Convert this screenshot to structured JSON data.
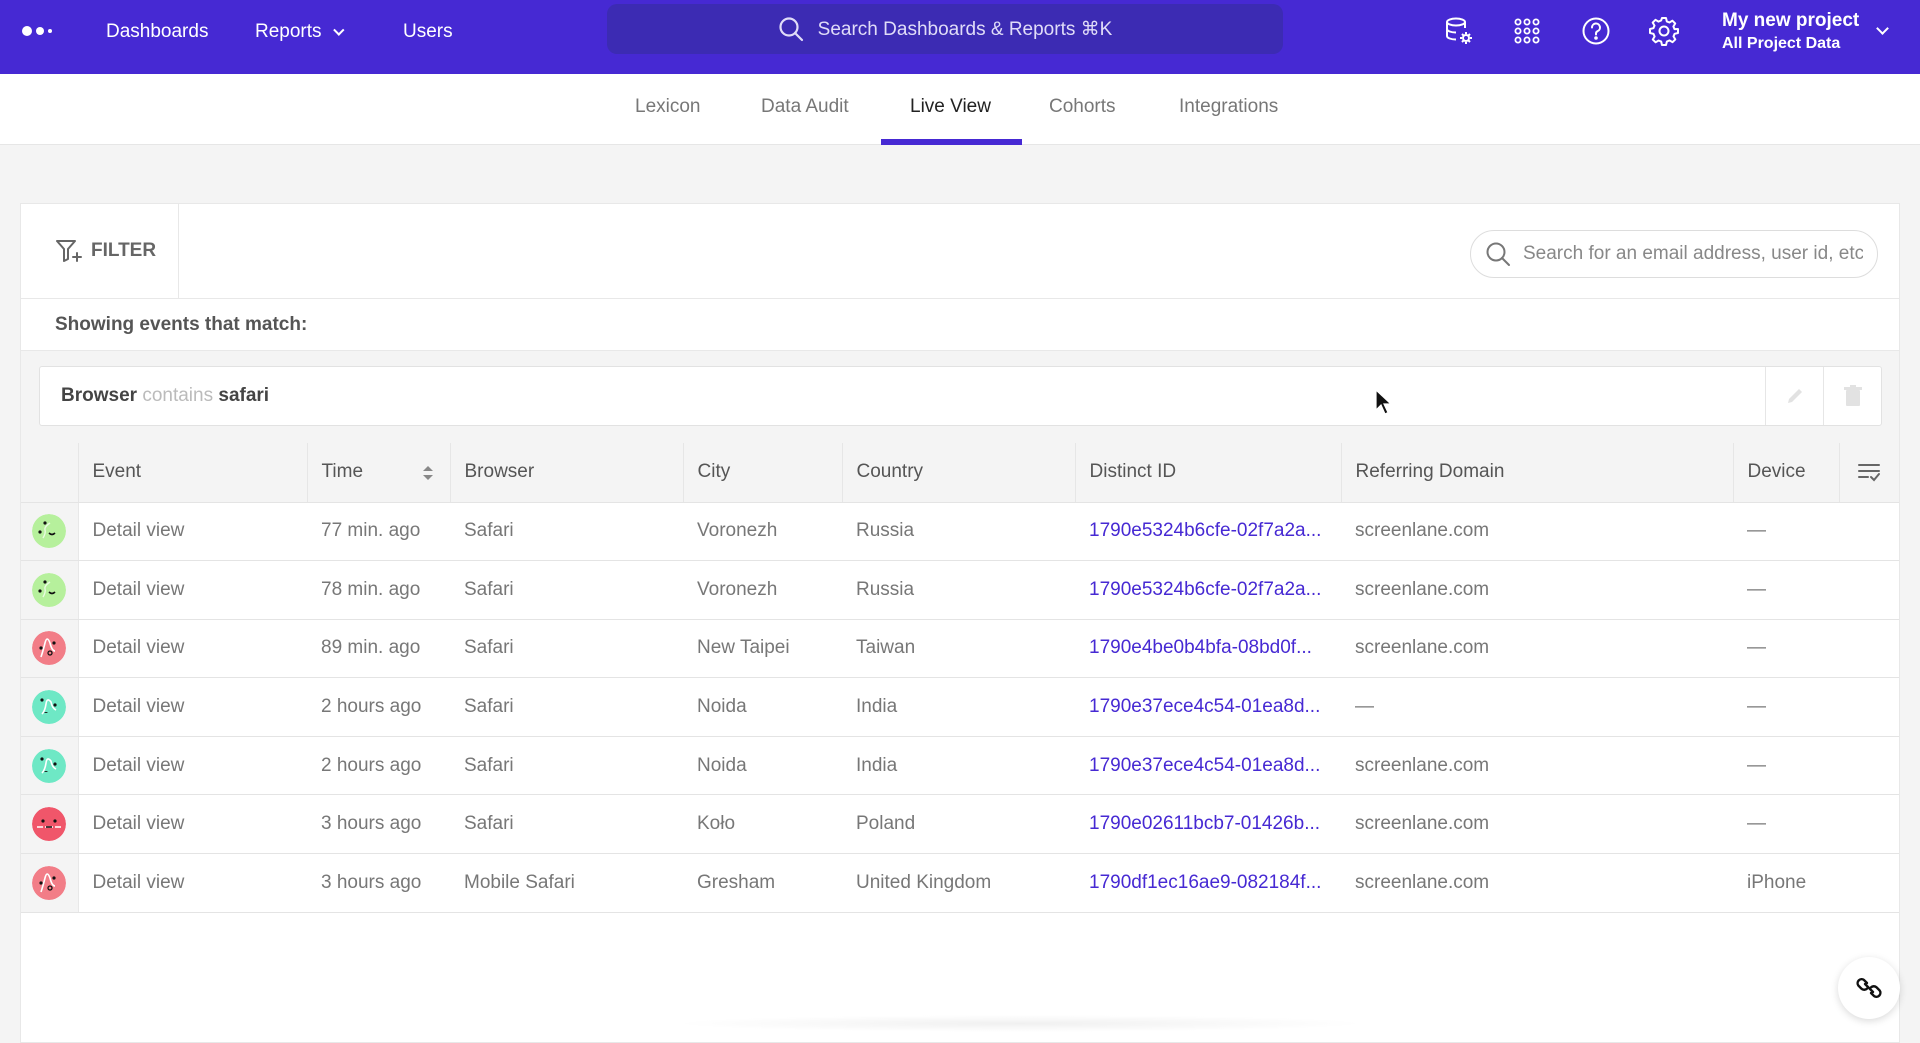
{
  "topnav": {
    "links": [
      {
        "label": "Dashboards"
      },
      {
        "label": "Reports",
        "has_dropdown": true
      },
      {
        "label": "Users"
      }
    ],
    "search_placeholder": "Search Dashboards & Reports ⌘K",
    "icons": [
      "data-settings-icon",
      "apps-grid-icon",
      "help-icon",
      "settings-gear-icon"
    ],
    "project": {
      "name": "My new project",
      "scope": "All Project Data"
    },
    "brand_color": "#4629d3"
  },
  "tabs": [
    {
      "label": "Lexicon",
      "active": false
    },
    {
      "label": "Data Audit",
      "active": false
    },
    {
      "label": "Live View",
      "active": true
    },
    {
      "label": "Cohorts",
      "active": false
    },
    {
      "label": "Integrations",
      "active": false
    }
  ],
  "filterbar": {
    "filter_label": "FILTER",
    "search_placeholder": "Search for an email address, user id, etc"
  },
  "showing_label": "Showing events that match:",
  "active_filter": {
    "property": "Browser",
    "operator": "contains",
    "value": "safari"
  },
  "table": {
    "columns": [
      "Event",
      "Time",
      "Browser",
      "City",
      "Country",
      "Distinct ID",
      "Referring Domain",
      "Device"
    ],
    "sort_column": "Time",
    "rows": [
      {
        "avatar": "green",
        "event": "Detail view",
        "time": "77 min. ago",
        "browser": "Safari",
        "city": "Voronezh",
        "country": "Russia",
        "distinct_id": "1790e5324b6cfe-02f7a2a...",
        "referring_domain": "screenlane.com",
        "device": "—"
      },
      {
        "avatar": "green",
        "event": "Detail view",
        "time": "78 min. ago",
        "browser": "Safari",
        "city": "Voronezh",
        "country": "Russia",
        "distinct_id": "1790e5324b6cfe-02f7a2a...",
        "referring_domain": "screenlane.com",
        "device": "—"
      },
      {
        "avatar": "pink",
        "event": "Detail view",
        "time": "89 min. ago",
        "browser": "Safari",
        "city": "New Taipei",
        "country": "Taiwan",
        "distinct_id": "1790e4be0b4bfa-08bd0f...",
        "referring_domain": "screenlane.com",
        "device": "—"
      },
      {
        "avatar": "teal",
        "event": "Detail view",
        "time": "2 hours ago",
        "browser": "Safari",
        "city": "Noida",
        "country": "India",
        "distinct_id": "1790e37ece4c54-01ea8d...",
        "referring_domain": "—",
        "device": "—"
      },
      {
        "avatar": "teal",
        "event": "Detail view",
        "time": "2 hours ago",
        "browser": "Safari",
        "city": "Noida",
        "country": "India",
        "distinct_id": "1790e37ece4c54-01ea8d...",
        "referring_domain": "screenlane.com",
        "device": "—"
      },
      {
        "avatar": "red",
        "event": "Detail view",
        "time": "3 hours ago",
        "browser": "Safari",
        "city": "Koło",
        "country": "Poland",
        "distinct_id": "1790e02611bcb7-01426b...",
        "referring_domain": "screenlane.com",
        "device": "—"
      },
      {
        "avatar": "pink",
        "event": "Detail view",
        "time": "3 hours ago",
        "browser": "Mobile Safari",
        "city": "Gresham",
        "country": "United Kingdom",
        "distinct_id": "1790df1ec16ae9-082184f...",
        "referring_domain": "screenlane.com",
        "device": "iPhone"
      }
    ]
  },
  "avatar_colors": {
    "green": "#b6f09c",
    "pink": "#f27d87",
    "teal": "#6ee8c5",
    "red": "#f0566a"
  },
  "fab_icon": "link-icon"
}
